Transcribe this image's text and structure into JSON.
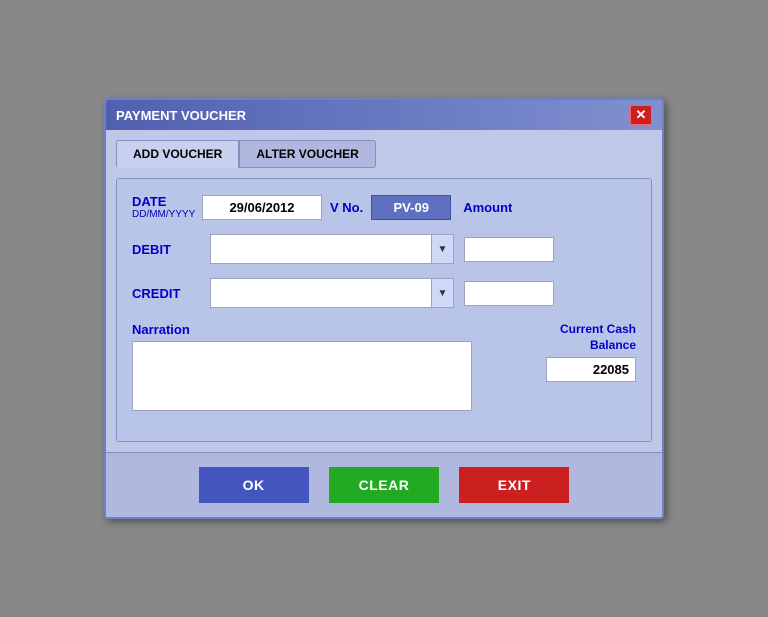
{
  "window": {
    "title": "PAYMENT VOUCHER",
    "close_label": "✕"
  },
  "tabs": [
    {
      "id": "add",
      "label": "ADD VOUCHER",
      "active": true
    },
    {
      "id": "alter",
      "label": "ALTER VOUCHER",
      "active": false
    }
  ],
  "form": {
    "date_label": "DATE",
    "date_format": "DD/MM/YYYY",
    "date_value": "29/06/2012",
    "vno_label": "V No.",
    "vno_value": "PV-09",
    "amount_label": "Amount",
    "debit_label": "DEBIT",
    "debit_value": "",
    "debit_amount": "",
    "credit_label": "CREDIT",
    "credit_value": "",
    "credit_amount": "",
    "narration_label": "Narration",
    "narration_value": "",
    "cash_balance_label": "Current Cash\nBalance",
    "cash_balance_value": "22085"
  },
  "buttons": {
    "ok_label": "OK",
    "clear_label": "CLEAR",
    "exit_label": "EXIT"
  },
  "icons": {
    "dropdown_arrow": "▼",
    "close": "✕"
  }
}
